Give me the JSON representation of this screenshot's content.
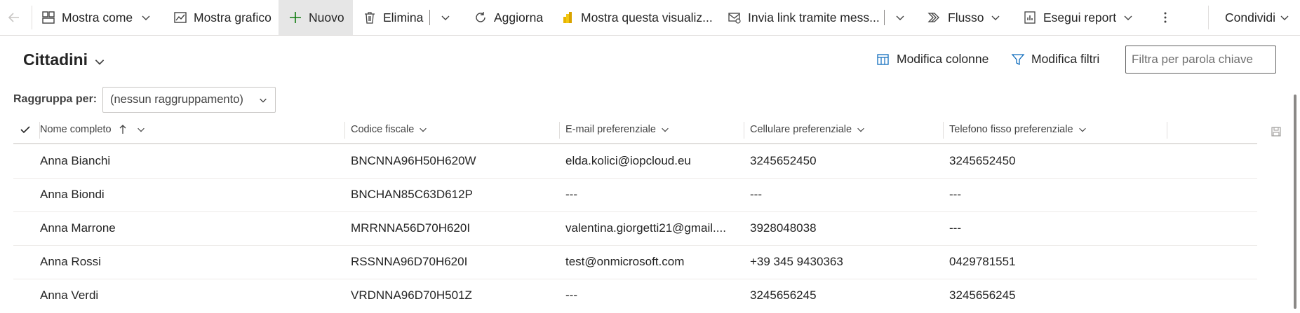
{
  "commandbar": {
    "show_as": "Mostra come",
    "show_chart": "Mostra grafico",
    "new": "Nuovo",
    "delete": "Elimina",
    "refresh": "Aggiorna",
    "show_visualization": "Mostra questa visualiz...",
    "send_link": "Invia link tramite mess...",
    "flow": "Flusso",
    "run_report": "Esegui report",
    "share": "Condividi"
  },
  "view": {
    "title": "Cittadini",
    "edit_columns": "Modifica colonne",
    "edit_filters": "Modifica filtri",
    "search_placeholder": "Filtra per parola chiave"
  },
  "group_by": {
    "label": "Raggruppa per:",
    "value": "(nessun raggruppamento)"
  },
  "grid": {
    "columns": [
      "Nome completo",
      "Codice fiscale",
      "E-mail preferenziale",
      "Cellulare preferenziale",
      "Telefono fisso preferenziale"
    ],
    "rows": [
      [
        "Anna Bianchi",
        "BNCNNA96H50H620W",
        "elda.kolici@iopcloud.eu",
        "3245652450",
        "3245652450"
      ],
      [
        "Anna Biondi",
        "BNCHAN85C63D612P",
        "---",
        "---",
        "---"
      ],
      [
        "Anna Marrone",
        "MRRNNA56D70H620I",
        "valentina.giorgetti21@gmail....",
        "3928048038",
        "---"
      ],
      [
        "Anna Rossi",
        "RSSNNA96D70H620I",
        "test@onmicrosoft.com",
        "+39 345 9430363",
        "0429781551"
      ],
      [
        "Anna Verdi",
        "VRDNNA96D70H501Z",
        "---",
        "3245656245",
        "3245656245"
      ]
    ]
  },
  "colors": {
    "accent_green": "#107c10",
    "active_bg": "#e6e6e6",
    "border": "#e1dfdd"
  }
}
